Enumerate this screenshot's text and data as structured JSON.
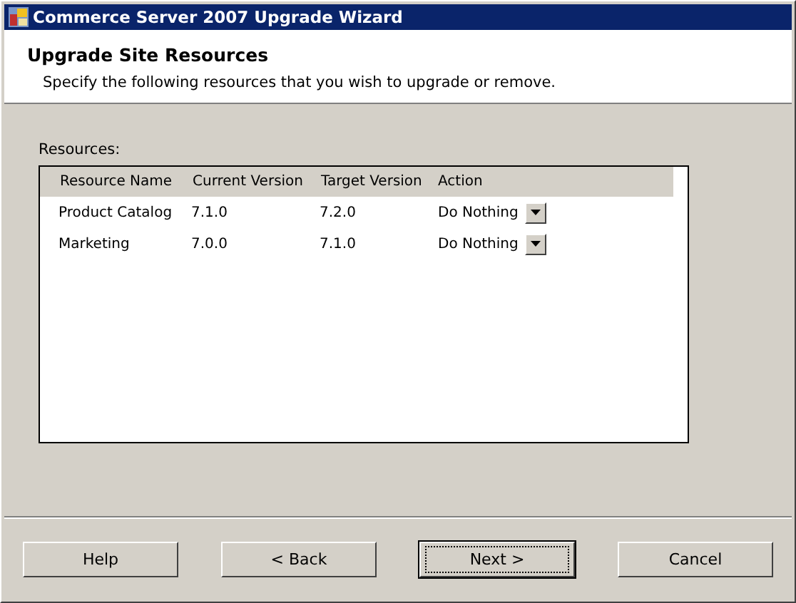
{
  "window": {
    "title": "Commerce Server 2007 Upgrade Wizard"
  },
  "header": {
    "title": "Upgrade Site Resources",
    "subtitle": "Specify the following resources that you wish to upgrade or remove."
  },
  "resources": {
    "label": "Resources:",
    "columns": [
      "Resource Name",
      "Current Version",
      "Target Version",
      "Action"
    ],
    "rows": [
      {
        "name": "Product Catalog",
        "current": "7.1.0",
        "target": "7.2.0",
        "action": "Do Nothing"
      },
      {
        "name": "Marketing",
        "current": "7.0.0",
        "target": "7.1.0",
        "action": "Do Nothing"
      }
    ]
  },
  "buttons": [
    {
      "label": "Help",
      "default": false
    },
    {
      "label": "< Back",
      "default": false
    },
    {
      "label": "Next >",
      "default": true
    },
    {
      "label": "Cancel",
      "default": false
    }
  ]
}
